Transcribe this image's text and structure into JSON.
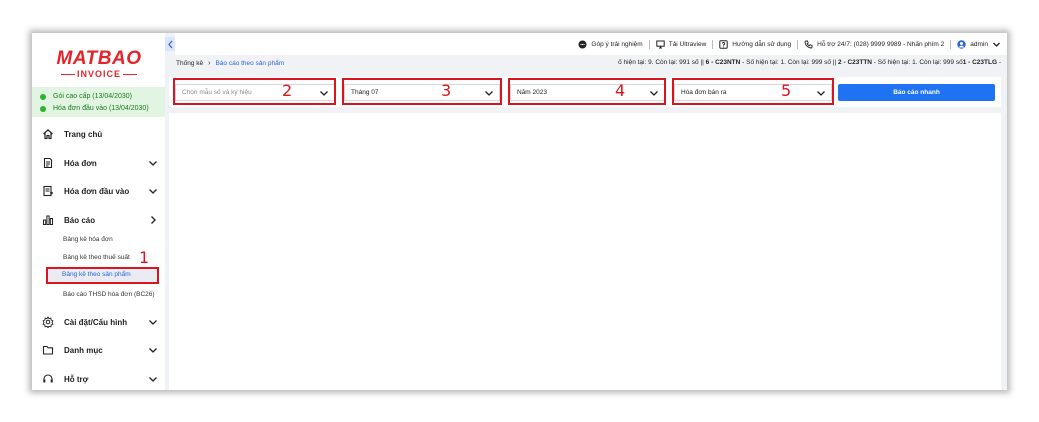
{
  "brand": {
    "top": "MATBAO",
    "bottom": "INVOICE"
  },
  "status": {
    "items": [
      {
        "label": "Gói cao cấp (13/04/2030)"
      },
      {
        "label": "Hóa đơn đầu vào (13/04/2030)"
      }
    ]
  },
  "sidebar": {
    "items": [
      {
        "label": "Trang chủ",
        "icon": "home-icon"
      },
      {
        "label": "Hóa đơn",
        "icon": "invoice-icon"
      },
      {
        "label": "Hóa đơn đầu vào",
        "icon": "input-invoice-icon"
      },
      {
        "label": "Báo cáo",
        "icon": "chart-icon"
      },
      {
        "label": "Cài đặt/Cấu hình",
        "icon": "gear-icon"
      },
      {
        "label": "Danh mục",
        "icon": "folder-icon"
      },
      {
        "label": "Hỗ trợ",
        "icon": "headset-icon"
      }
    ],
    "report_sub": [
      {
        "label": "Bảng kê hóa đơn"
      },
      {
        "label": "Bảng kê theo thuế suất"
      },
      {
        "label": "Bảng kê theo sản phẩm",
        "active": true
      },
      {
        "label": "Báo cáo THSD hóa đơn (BC26)"
      }
    ]
  },
  "topbar": {
    "feedback": "Góp ý trải nghiệm",
    "download": "Tải Ultraview",
    "guide": "Hướng dẫn sử dụng",
    "support": "Hỗ trợ 24/7: (028) 9999 9989 - Nhấn phím 2",
    "user": "admin"
  },
  "breadcrumb": {
    "root": "Thống kê",
    "current": "Báo cáo theo sản phẩm"
  },
  "ticker": {
    "parts": [
      {
        "text": "ố hiện tại: 9. Còn lại: 991 số  ||  ",
        "bold": false
      },
      {
        "text": "6 - C23NTN",
        "bold": true
      },
      {
        "text": "  - Số hiện tại: 1. Còn lại: 999 số  ||  ",
        "bold": false
      },
      {
        "text": "2 - C23TTN",
        "bold": true
      },
      {
        "text": "  - Số hiện tại: 1. Còn lại: 999 số",
        "bold": false
      },
      {
        "text": "1 - C23TLG",
        "bold": true
      },
      {
        "text": "  -",
        "bold": false
      }
    ]
  },
  "filters": {
    "template": {
      "placeholder": "Chọn mẫu số và ký hiệu"
    },
    "month": {
      "value": "Tháng 07"
    },
    "year": {
      "value": "Năm 2023"
    },
    "type": {
      "value": "Hóa đơn bán ra"
    },
    "report_button": "Báo cáo nhanh"
  },
  "annotations": [
    "1",
    "2",
    "3",
    "4",
    "5"
  ],
  "colors": {
    "brand_red": "#e3242b",
    "highlight_red": "#d9161f",
    "primary_blue": "#1f72f2",
    "link_blue": "#2f63d6",
    "status_green": "#27b52a",
    "status_bg": "#e2f5e2"
  }
}
